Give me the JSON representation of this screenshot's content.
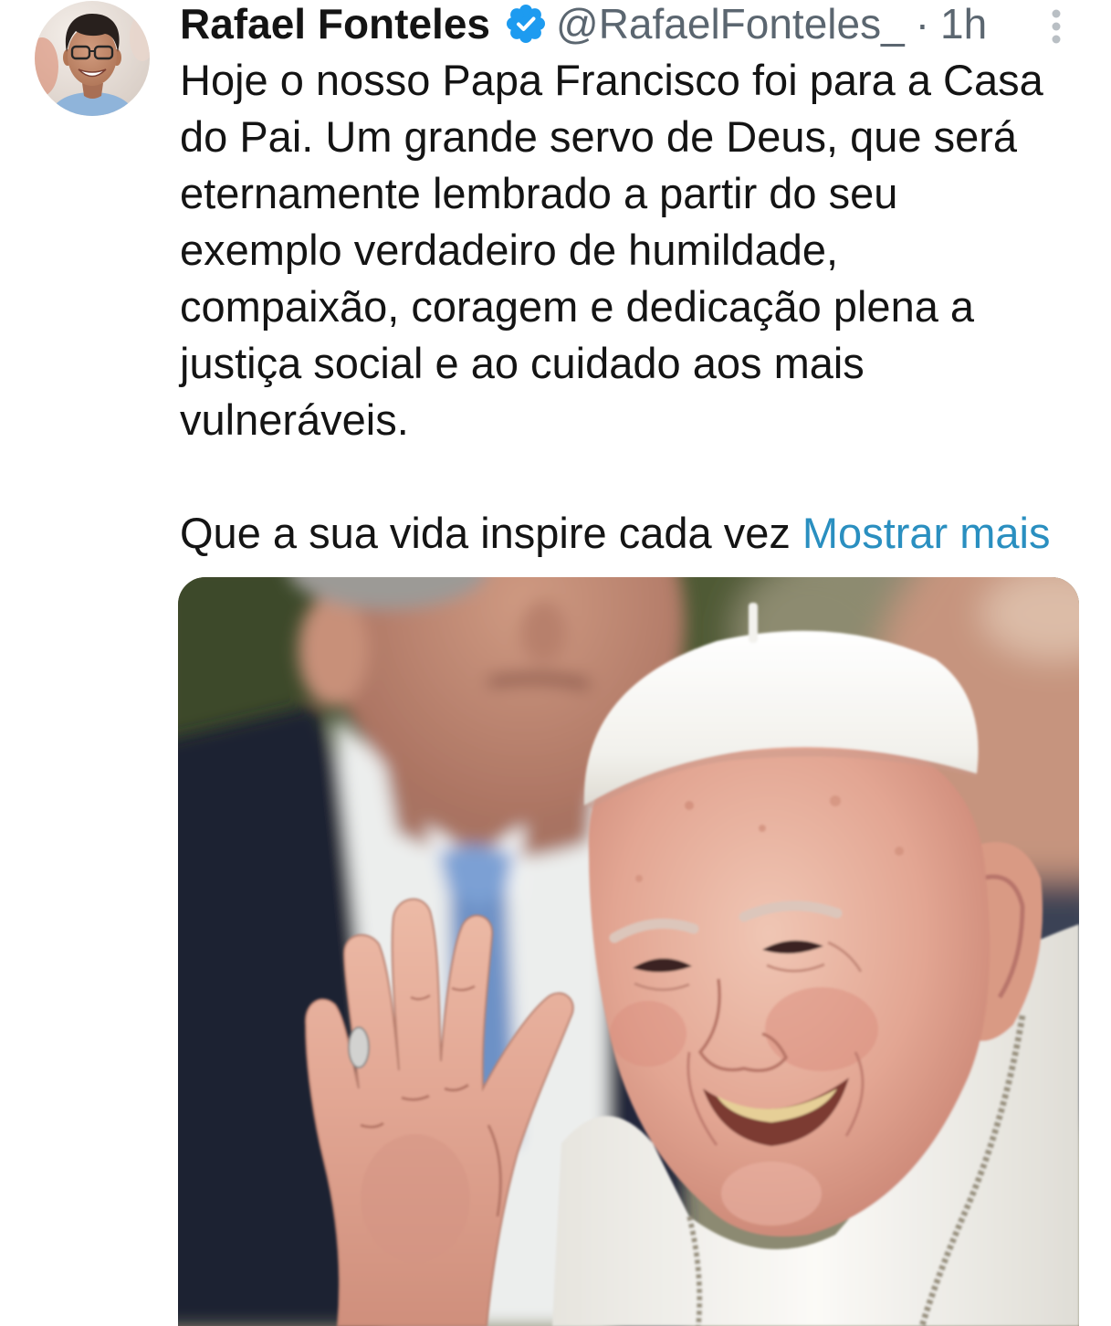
{
  "tweet": {
    "author": {
      "name": "Rafael Fonteles",
      "handle": "@RafaelFonteles_",
      "verified": true
    },
    "separator": "·",
    "time": "1h",
    "text_lines": [
      "Hoje o nosso Papa Francisco foi para a Casa",
      "do Pai. Um grande servo de Deus, que será",
      "eternamente lembrado a partir do seu",
      "exemplo verdadeiro de humildade,",
      "compaixão, coragem e dedicação plena a",
      "justiça social e ao cuidado aos mais",
      "vulneráveis."
    ],
    "text_tail": "Que a sua vida inspire cada vez",
    "show_more_label": "Mostrar mais"
  },
  "icons": {
    "avatar": "profile-photo-avatar",
    "verified": "verified-badge-icon",
    "more": "more-vertical-icon"
  },
  "colors": {
    "text": "#141414",
    "secondary": "#5b6670",
    "link": "#2a8fc0",
    "verified": "#1d9bf0",
    "more_icon": "#b9bfc4"
  }
}
